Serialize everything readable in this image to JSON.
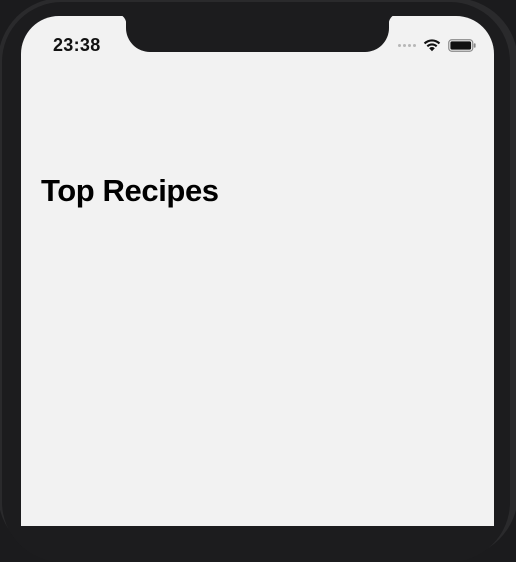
{
  "status_bar": {
    "time": "23:38",
    "icons": [
      "signal-dots-icon",
      "wifi-icon",
      "battery-icon"
    ]
  },
  "nav": {
    "title": "Top Recipes"
  },
  "colors": {
    "screen_background": "#f2f2f2",
    "device_frame": "#1c1c1e",
    "title_text": "#000000"
  }
}
